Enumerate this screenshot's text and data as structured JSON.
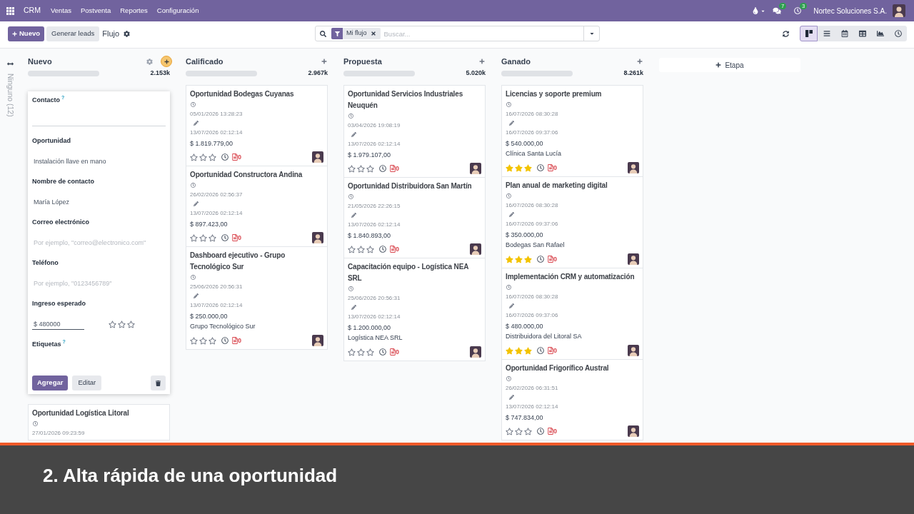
{
  "navbar": {
    "app_name": "CRM",
    "menu": [
      "Ventas",
      "Postventa",
      "Reportes",
      "Configuración"
    ],
    "messages_count": "7",
    "activities_count": "3",
    "company": "Nortec Soluciones S.A."
  },
  "control_panel": {
    "new_button": "Nuevo",
    "generate_button": "Generar leads",
    "title": "Flujo",
    "search": {
      "facet": "Mi flujo",
      "placeholder": "Buscar..."
    },
    "views": [
      {
        "kind": "kanban",
        "selected": true
      },
      {
        "kind": "list",
        "selected": false
      },
      {
        "kind": "calendar",
        "selected": false
      },
      {
        "kind": "pivot",
        "selected": false
      },
      {
        "kind": "graph",
        "selected": false
      },
      {
        "kind": "activity",
        "selected": false
      }
    ]
  },
  "folded_column": {
    "label": "Ninguno (12)"
  },
  "columns": [
    {
      "title": "Nuevo",
      "total": "2.153k",
      "quick_create": {
        "fields": [
          {
            "kind": "relation",
            "label": "Contacto",
            "help": "?",
            "focused": false
          },
          {
            "kind": "text",
            "label": "Oportunidad",
            "value": "Instalación llave en mano",
            "focused": false
          },
          {
            "kind": "text",
            "label": "Nombre de contacto",
            "value": "María López",
            "focused": false
          },
          {
            "kind": "text",
            "label": "Correo electrónico",
            "placeholder": "Por ejemplo, \"correo@electronico.com\"",
            "focused": false
          },
          {
            "kind": "text",
            "label": "Teléfono",
            "placeholder": "Por ejemplo, \"0123456789\"",
            "focused": false
          },
          {
            "kind": "amount",
            "label": "Ingreso esperado",
            "value": "$ 480000",
            "focused": true,
            "stars": 0
          },
          {
            "kind": "tags",
            "label": "Etiquetas",
            "help": "?"
          }
        ],
        "add_button": "Agregar",
        "edit_button": "Editar"
      },
      "cards": [
        {
          "title": "Oportunidad Logística Litoral",
          "created": "27/01/2026 09:23:59"
        }
      ]
    },
    {
      "title": "Calificado",
      "total": "2.967k",
      "cards": [
        {
          "title": "Oportunidad Bodegas Cuyanas",
          "created": "05/01/2026 13:28:23",
          "updated": "13/07/2026 02:12:14",
          "amount": "$ 1.819.779,00",
          "stars": 0,
          "document_count": "0"
        },
        {
          "title": "Oportunidad Constructora Andina",
          "created": "26/02/2026 02:56:37",
          "updated": "13/07/2026 02:12:14",
          "amount": "$ 897.423,00",
          "stars": 0,
          "document_count": "0"
        },
        {
          "title": "Dashboard ejecutivo - Grupo Tecnológico Sur",
          "created": "25/06/2026 20:56:31",
          "updated": "13/07/2026 02:12:14",
          "amount": "$ 250.000,00",
          "partner": "Grupo Tecnológico Sur",
          "stars": 0,
          "document_count": "0"
        }
      ]
    },
    {
      "title": "Propuesta",
      "total": "5.020k",
      "cards": [
        {
          "title": "Oportunidad Servicios Industriales Neuquén",
          "created": "03/04/2026 19:08:19",
          "updated": "13/07/2026 02:12:14",
          "amount": "$ 1.979.107,00",
          "stars": 0,
          "document_count": "0"
        },
        {
          "title": "Oportunidad Distribuidora San Martín",
          "created": "21/05/2026 22:26:15",
          "updated": "13/07/2026 02:12:14",
          "amount": "$ 1.840.893,00",
          "stars": 0,
          "document_count": "0"
        },
        {
          "title": "Capacitación equipo - Logística NEA SRL",
          "created": "25/06/2026 20:56:31",
          "updated": "13/07/2026 02:12:14",
          "amount": "$ 1.200.000,00",
          "partner": "Logística NEA SRL",
          "stars": 0,
          "document_count": "0"
        }
      ]
    },
    {
      "title": "Ganado",
      "total": "8.261k",
      "cards": [
        {
          "title": "Licencias y soporte premium",
          "created": "16/07/2026 08:30:28",
          "updated": "16/07/2026 09:37:06",
          "amount": "$ 540.000,00",
          "partner": "Clínica Santa Lucía",
          "stars": 3,
          "document_count": "0"
        },
        {
          "title": "Plan anual de marketing digital",
          "created": "16/07/2026 08:30:28",
          "updated": "16/07/2026 09:37:06",
          "amount": "$ 350.000,00",
          "partner": "Bodegas San Rafael",
          "stars": 3,
          "document_count": "0"
        },
        {
          "title": "Implementación CRM y automatización",
          "created": "16/07/2026 08:30:28",
          "updated": "16/07/2026 09:37:06",
          "amount": "$ 480.000,00",
          "partner": "Distribuidora del Litoral SA",
          "stars": 3,
          "document_count": "0"
        },
        {
          "title": "Oportunidad Frigorífico Austral",
          "created": "26/02/2026 06:31:51",
          "updated": "13/07/2026 02:12:14",
          "amount": "$ 747.834,00",
          "stars": 0,
          "document_count": "0"
        }
      ]
    }
  ],
  "add_stage_button": "Etapa",
  "caption": "2. Alta rápida de una oportunidad"
}
